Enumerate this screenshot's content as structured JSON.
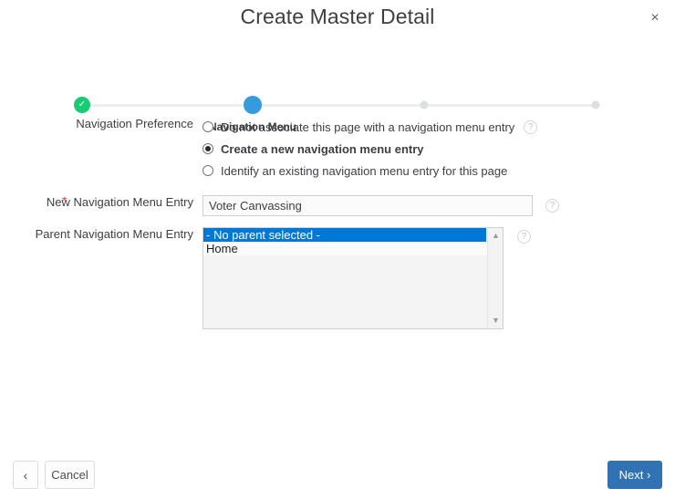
{
  "dialog": {
    "title": "Create Master Detail",
    "close_label": "×"
  },
  "stepper": {
    "current_label": "Navigation Menu",
    "check_glyph": "✓",
    "steps": [
      {
        "state": "done"
      },
      {
        "state": "current",
        "label": "Navigation Menu"
      },
      {
        "state": "pending"
      },
      {
        "state": "pending"
      }
    ],
    "accent_done": "#19cb72",
    "accent_current": "#359bde",
    "accent_pending": "#dcdfe2"
  },
  "form": {
    "navigation_preference": {
      "label": "Navigation Preference",
      "options": [
        {
          "label": "Do not associate this page with a navigation menu entry",
          "selected": false,
          "has_help": true
        },
        {
          "label": "Create a new navigation menu entry",
          "selected": true,
          "has_help": false
        },
        {
          "label": "Identify an existing navigation menu entry for this page",
          "selected": false,
          "has_help": false
        }
      ]
    },
    "new_navigation_menu_entry": {
      "label": "New Navigation Menu Entry",
      "required_marker": "*",
      "value": "Voter Canvassing",
      "placeholder": ""
    },
    "parent_navigation_menu_entry": {
      "label": "Parent Navigation Menu Entry",
      "options": [
        {
          "label": "- No parent selected -",
          "selected": true
        },
        {
          "label": "Home",
          "selected": false
        }
      ]
    },
    "help_glyph": "?"
  },
  "footer": {
    "back_glyph": "‹",
    "cancel_label": "Cancel",
    "next_label": "Next",
    "next_glyph": "›",
    "next_color": "#3172b5"
  }
}
